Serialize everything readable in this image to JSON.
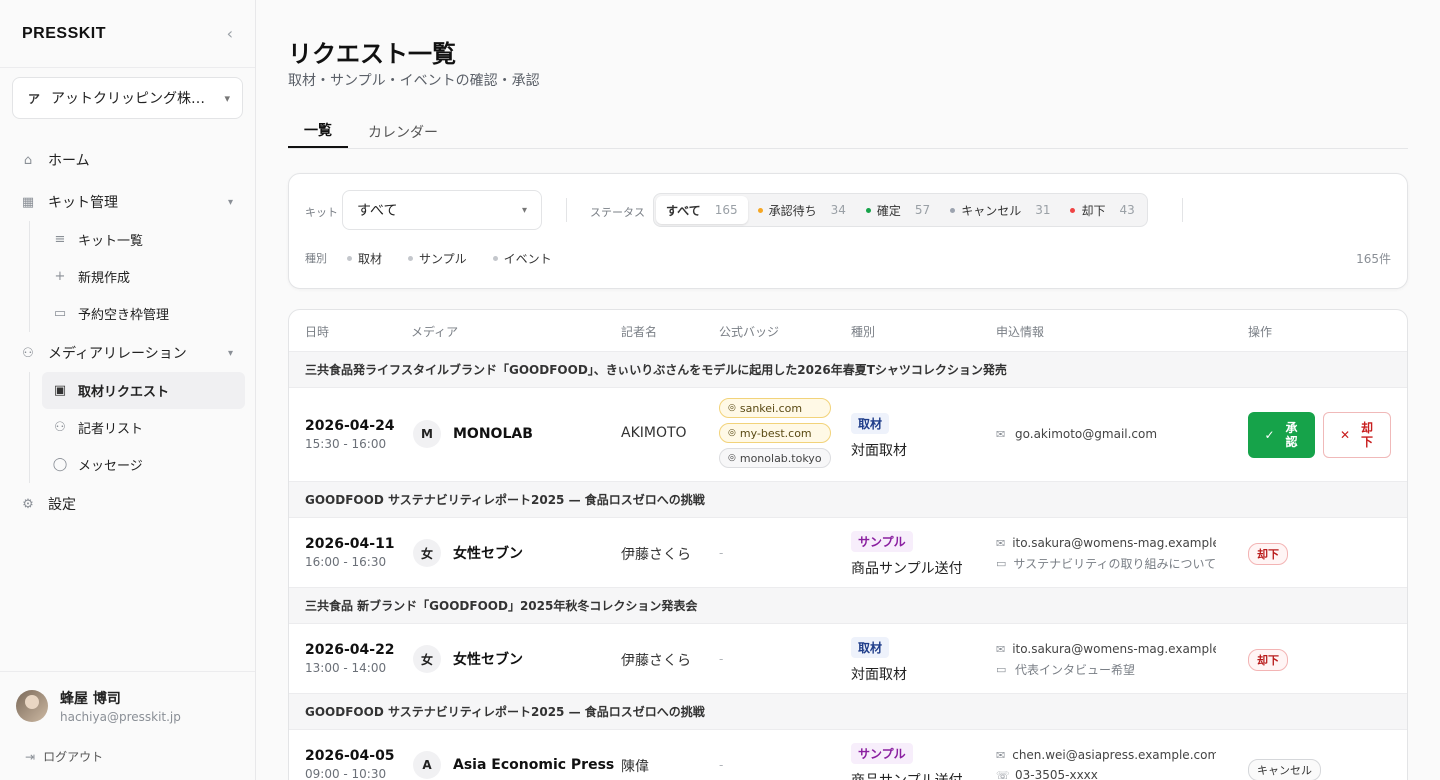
{
  "sidebar": {
    "logo": "PRESSKIT",
    "collapse_icon": "‹",
    "org": {
      "initial": "ア",
      "name": "アットクリッピング株式会社"
    },
    "nav": {
      "home": "ホーム",
      "kit": "キット管理",
      "kit_list": "キット一覧",
      "kit_new": "新規作成",
      "kit_slots": "予約空き枠管理",
      "media": "メディアリレーション",
      "requests": "取材リクエスト",
      "reporters": "記者リスト",
      "messages": "メッセージ",
      "settings": "設定"
    },
    "user": {
      "name": "蜂屋 博司",
      "email": "hachiya@presskit.jp",
      "logout": "ログアウト"
    }
  },
  "header": {
    "title": "リクエスト一覧",
    "subtitle": "取材・サンプル・イベントの確認・承認"
  },
  "tabs": [
    {
      "label": "一覧"
    },
    {
      "label": "カレンダー"
    }
  ],
  "filters": {
    "kit_label": "キット",
    "kit_value": "すべて",
    "status_label": "ステータス",
    "status_options": [
      {
        "label": "すべて",
        "count": "165"
      },
      {
        "label": "承認待ち",
        "count": "34",
        "color": "#f5a623"
      },
      {
        "label": "確定",
        "count": "57",
        "color": "#16a34a"
      },
      {
        "label": "キャンセル",
        "count": "31",
        "color": "#9ca3af"
      },
      {
        "label": "却下",
        "count": "43",
        "color": "#ef4444"
      }
    ],
    "type_label": "種別",
    "types": [
      "取材",
      "サンプル",
      "イベント"
    ],
    "total": "165件"
  },
  "table": {
    "headers": [
      "日時",
      "メディア",
      "記者名",
      "公式バッジ",
      "種別",
      "申込情報",
      "操作"
    ],
    "groups": [
      {
        "title": "三共食品発ライフスタイルブランド「GOODFOOD」、きぃいりぶさんをモデルに起用した2026年春夏Tシャツコレクション発売",
        "row": {
          "date": "2026-04-24",
          "time": "15:30 - 16:00",
          "media_initial": "M",
          "media": "MONOLAB",
          "reporter": "AKIMOTO",
          "badges": [
            "sankei.com",
            "my-best.com",
            "monolab.tokyo"
          ],
          "kind_tag": "取材",
          "kind_desc": "対面取材",
          "email": "go.akimoto@gmail.com",
          "approve": "承認",
          "reject": "却下"
        }
      },
      {
        "title": "GOODFOOD サステナビリティレポート2025 — 食品ロスゼロへの挑戦",
        "row": {
          "date": "2026-04-11",
          "time": "16:00 - 16:30",
          "media_initial": "女",
          "media": "女性セブン",
          "reporter": "伊藤さくら",
          "badge_empty": "-",
          "kind_tag": "サンプル",
          "kind_desc": "商品サンプル送付",
          "email": "ito.sakura@womens-mag.example.com",
          "note": "サステナビリティの取り組みについて",
          "status": "却下"
        }
      },
      {
        "title": "三共食品 新ブランド「GOODFOOD」2025年秋冬コレクション発表会",
        "row": {
          "date": "2026-04-22",
          "time": "13:00 - 14:00",
          "media_initial": "女",
          "media": "女性セブン",
          "reporter": "伊藤さくら",
          "badge_empty": "-",
          "kind_tag": "取材",
          "kind_desc": "対面取材",
          "email": "ito.sakura@womens-mag.example.com",
          "note": "代表インタビュー希望",
          "status": "却下"
        }
      },
      {
        "title": "GOODFOOD サステナビリティレポート2025 — 食品ロスゼロへの挑戦",
        "row": {
          "date": "2026-04-05",
          "time": "09:00 - 10:30",
          "media_initial": "A",
          "media": "Asia Economic Press",
          "reporter": "陳偉",
          "badge_empty": "-",
          "kind_tag": "サンプル",
          "kind_desc": "商品サンプル送付",
          "email": "chen.wei@asiapress.example.com",
          "phone": "03-3505-xxxx",
          "status": "キャンセル"
        }
      }
    ]
  },
  "colors": {
    "accent": "#16a34a",
    "danger": "#c81e1e",
    "pending": "#f5a623"
  }
}
